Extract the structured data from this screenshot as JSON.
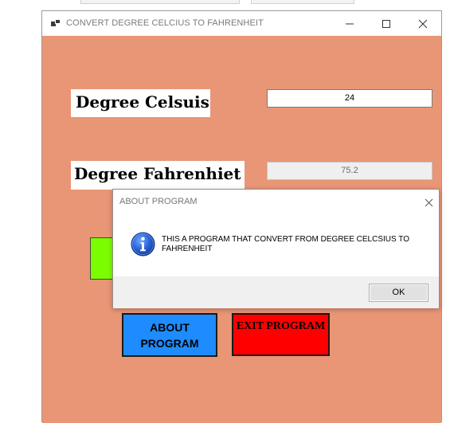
{
  "window": {
    "title": "CONVERT DEGREE CELCIUS TO FAHRENHEIT",
    "minimize_icon": "minimize-icon",
    "maximize_icon": "maximize-icon",
    "close_icon": "close-icon"
  },
  "form": {
    "celsius_label": "Degree Celsuis",
    "celsius_value": "24",
    "fahrenheit_label": "Degree Fahrenhiet",
    "fahrenheit_value": "75.2",
    "about_button": "ABOUT PROGRAM",
    "exit_button": "EXIT PROGRAM"
  },
  "dialog": {
    "title": "ABOUT PROGRAM",
    "message": "THIS A PROGRAM THAT CONVERT FROM DEGREE CELCSIUS TO FAHRENHEIT",
    "ok_label": "OK",
    "icon": "info-icon"
  },
  "colors": {
    "form_background": "#e89676",
    "about_button": "#1e8cff",
    "exit_button": "#ff0000",
    "convert_button": "#7cfc00"
  }
}
